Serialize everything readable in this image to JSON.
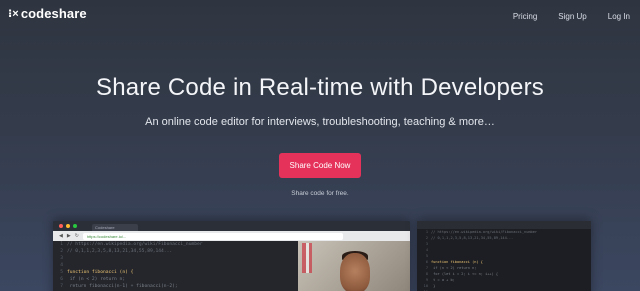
{
  "brand": {
    "mark": "⁝×",
    "name": "codeshare"
  },
  "nav": {
    "pricing": "Pricing",
    "signup": "Sign Up",
    "login": "Log In"
  },
  "hero": {
    "title": "Share Code in Real-time with Developers",
    "subtitle": "An online code editor for interviews, troubleshooting, teaching & more…",
    "cta_label": "Share Code Now",
    "note": "Share code for free."
  },
  "mockup": {
    "tab_label": "Codeshare",
    "url": "https://codeshare.io/...",
    "code_lines": [
      "// https://en.wikipedia.org/wiki/Fibonacci_number",
      "// 0,1,1,2,3,5,8,13,21,34,55,89,144...",
      "",
      "",
      "function fibonacci (n) {",
      "  if (n < 2) return n;",
      "  return fibonacci(n-1) + fibonacci(n-2);"
    ],
    "side_lines": [
      "// https://en.wikipedia.org/wiki/Fibonacci_number",
      "// 0,1,1,2,3,5,8,13,21,34,55,89,144...",
      "",
      "",
      "",
      "function fibonacci (n) {",
      "  if (n < 2) return n;",
      "  for (let i = 2; i <= n; i++) {",
      "    t = a + b;",
      "  }",
      ""
    ]
  },
  "colors": {
    "accent": "#e5325a",
    "bg_top": "#2f3540",
    "bg_bottom": "#3b4660"
  }
}
